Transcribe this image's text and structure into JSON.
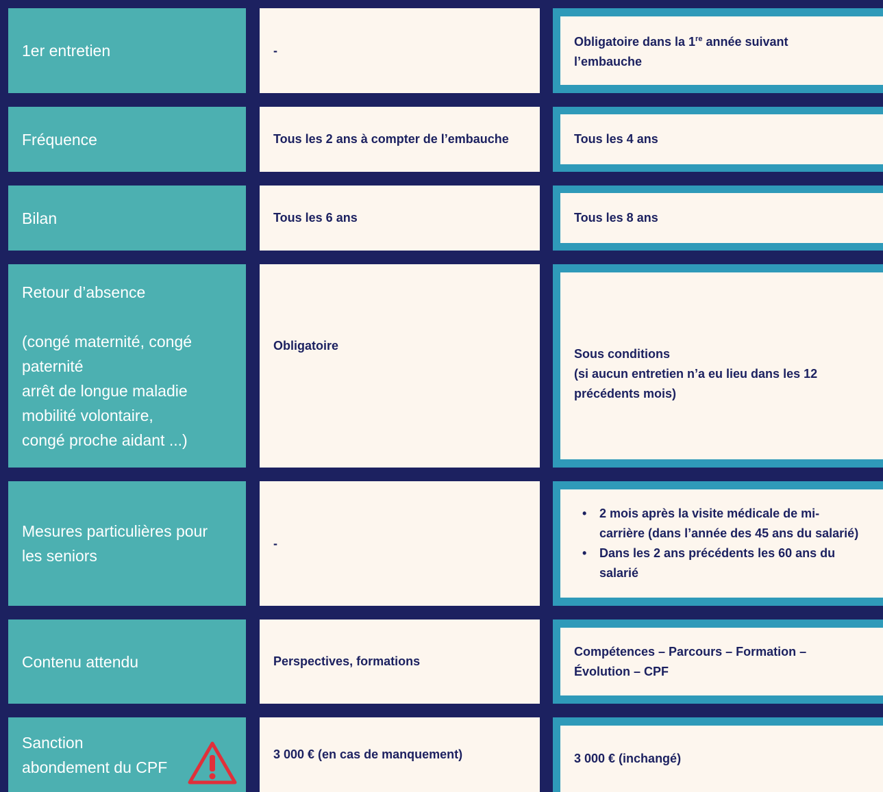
{
  "rows": [
    {
      "label": "1er entretien",
      "mid": "-",
      "right": {
        "pre": "Obligatoire dans la 1",
        "sup": "re",
        "post": " année suivant",
        "line2": "l’embauche"
      }
    },
    {
      "label": "Fréquence",
      "mid": "Tous les 2 ans à compter de l’embauche",
      "right": "Tous les 4 ans"
    },
    {
      "label": "Bilan",
      "mid": "Tous les 6 ans",
      "right": "Tous les 8 ans"
    },
    {
      "label_lines": [
        "Retour d’absence",
        "",
        "(congé maternité, congé",
        "paternité",
        "arrêt de longue maladie",
        "mobilité volontaire,",
        "congé proche aidant ...)"
      ],
      "mid": "Obligatoire",
      "right_lines": [
        "Sous conditions",
        "(si aucun entretien n’a eu lieu dans les 12",
        "précédents mois)"
      ]
    },
    {
      "label_lines": [
        "Mesures particulières pour",
        "les seniors"
      ],
      "mid": "-",
      "right_bullets": [
        {
          "lines": [
            "2 mois après la visite médicale de mi-",
            "carrière (dans l’année des 45 ans du salarié)"
          ]
        },
        {
          "lines": [
            "Dans les 2 ans précédents les 60 ans du",
            "salarié"
          ]
        }
      ]
    },
    {
      "label": "Contenu attendu",
      "mid": "Perspectives, formations",
      "right_lines": [
        "Compétences – Parcours – Formation –",
        "Évolution – CPF"
      ]
    },
    {
      "label_lines": [
        "Sanction",
        "abondement du CPF"
      ],
      "mid": "3 000 € (en cas de manquement)",
      "right": "3 000 € (inchangé)",
      "icon": "warning-icon",
      "icon_color": "#e0303a"
    }
  ],
  "colors": {
    "background": "#1c2160",
    "label_bg": "#4cb0b1",
    "cell_bg": "#fdf6ee",
    "accent": "#2f9ab9",
    "text": "#1c2160"
  }
}
